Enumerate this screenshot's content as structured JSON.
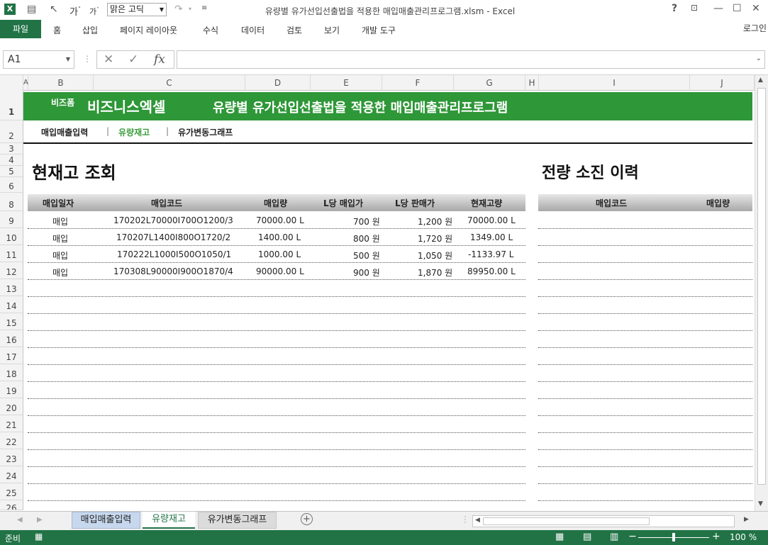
{
  "window": {
    "title": "유량별 유가선입선출법을 적용한 매입매출관리프로그램.xlsm - Excel",
    "font": "맑은 고딕",
    "help": "?",
    "login": "로그인"
  },
  "ribbon": {
    "file": "파일",
    "tabs": [
      "홈",
      "삽입",
      "페이지 레이아웃",
      "수식",
      "데이터",
      "검토",
      "보기",
      "개발 도구"
    ]
  },
  "formula": {
    "cell": "A1",
    "fx": "fx",
    "value": ""
  },
  "columns": [
    "A",
    "B",
    "C",
    "D",
    "E",
    "F",
    "G",
    "H",
    "I",
    "J"
  ],
  "rows": [
    "1",
    "2",
    "3",
    "4",
    "5",
    "6",
    "8",
    "9",
    "10",
    "11",
    "12",
    "13",
    "14",
    "15",
    "16",
    "17",
    "18",
    "19",
    "20",
    "21",
    "22",
    "23",
    "24",
    "25",
    "26"
  ],
  "banner": {
    "brand_small": "비즈폼",
    "brand_big": "비즈니스엑셀",
    "title": "유량별 유가선입선출법을 적용한 매입매출관리프로그램"
  },
  "nav": {
    "items": [
      "매입매출입력",
      "유량재고",
      "유가변동그래프"
    ],
    "active": "유량재고",
    "sep": "|"
  },
  "section1": {
    "title": "현재고 조회",
    "headers": [
      "매입일자",
      "매입코드",
      "매입량",
      "L당 매입가",
      "L당 판매가",
      "현재고량"
    ],
    "rows": [
      [
        "매입",
        "170202L70000I700O1200/3",
        "70000.00 L",
        "700 원",
        "1,200 원",
        "70000.00 L"
      ],
      [
        "매입",
        "170207L1400I800O1720/2",
        "1400.00 L",
        "800 원",
        "1,720 원",
        "1349.00 L"
      ],
      [
        "매입",
        "170222L1000I500O1050/1",
        "1000.00 L",
        "500 원",
        "1,050 원",
        "-1133.97 L"
      ],
      [
        "매입",
        "170308L90000I900O1870/4",
        "90000.00 L",
        "900 원",
        "1,870 원",
        "89950.00 L"
      ]
    ]
  },
  "section2": {
    "title": "전량 소진 이력",
    "headers": [
      "매입코드",
      "매입량"
    ]
  },
  "sheet_tabs": [
    "매입매출입력",
    "유량재고",
    "유가변동그래프"
  ],
  "status": {
    "ready": "준비",
    "zoom": "100 %"
  },
  "colors": {
    "excel_green": "#217346",
    "banner_green": "#2e9737",
    "active_nav": "#3a9d3a"
  }
}
